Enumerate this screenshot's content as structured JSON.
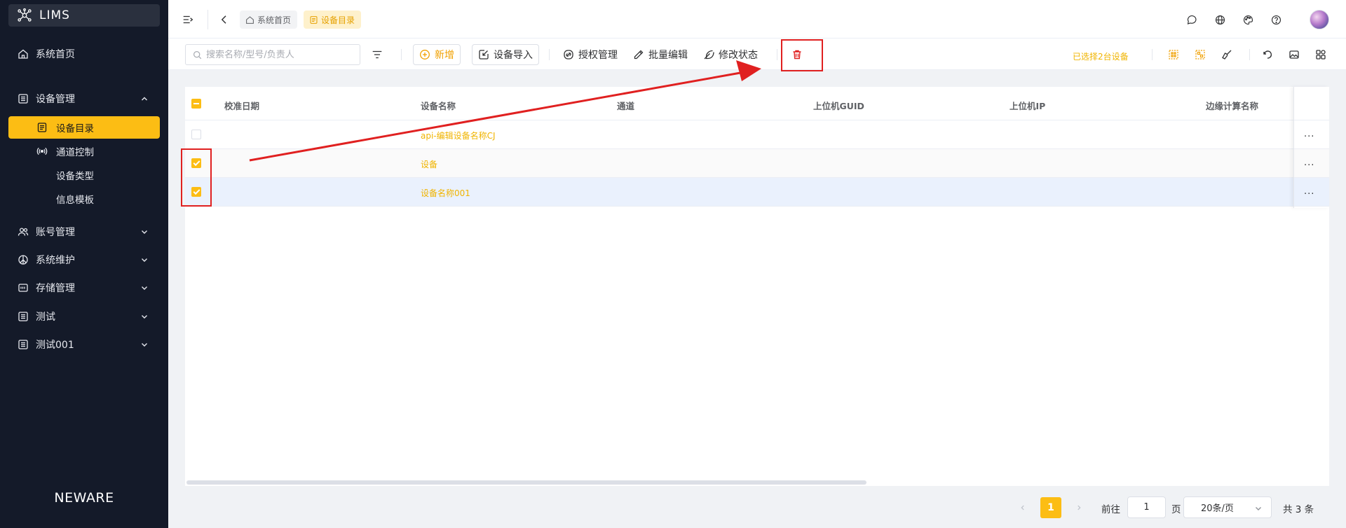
{
  "app": {
    "name": "LIMS",
    "footer_brand": "NEWARE"
  },
  "sidebar": {
    "home": "系统首页",
    "device_mgmt": {
      "label": "设备管理",
      "children": [
        "设备目录",
        "通道控制",
        "设备类型",
        "信息模板"
      ]
    },
    "groups": [
      "账号管理",
      "系统维护",
      "存储管理",
      "测试",
      "测试001"
    ]
  },
  "breadcrumbs": [
    {
      "label": "系统首页",
      "icon": "home-icon"
    },
    {
      "label": "设备目录",
      "icon": "document-icon"
    }
  ],
  "toolbar": {
    "search_placeholder": "搜索名称/型号/负责人",
    "add": "新增",
    "import": "设备导入",
    "auth": "授权管理",
    "batch_edit": "批量编辑",
    "change_status": "修改状态",
    "selected_info": "已选择2台设备"
  },
  "table": {
    "columns": [
      "校准日期",
      "设备名称",
      "通道",
      "上位机GUID",
      "上位机IP",
      "边缘计算名称"
    ],
    "rows": [
      {
        "checked": false,
        "calib_date": "",
        "name": "api-编辑设备名称CJ",
        "channel": "",
        "guid": "",
        "ip": "",
        "edge": ""
      },
      {
        "checked": true,
        "calib_date": "",
        "name": "设备",
        "channel": "",
        "guid": "",
        "ip": "",
        "edge": ""
      },
      {
        "checked": true,
        "calib_date": "",
        "name": "设备名称001",
        "channel": "",
        "guid": "",
        "ip": "",
        "edge": ""
      }
    ],
    "row_action": "..."
  },
  "pagination": {
    "current_page": "1",
    "goto_label": "前往",
    "goto_value": "1",
    "page_unit": "页",
    "page_size": "20条/页",
    "total": "共 3 条"
  },
  "colors": {
    "accent": "#fcbd14",
    "sidebar_bg": "#141a29",
    "annotation_red": "#e02020",
    "link": "#f0b400"
  }
}
